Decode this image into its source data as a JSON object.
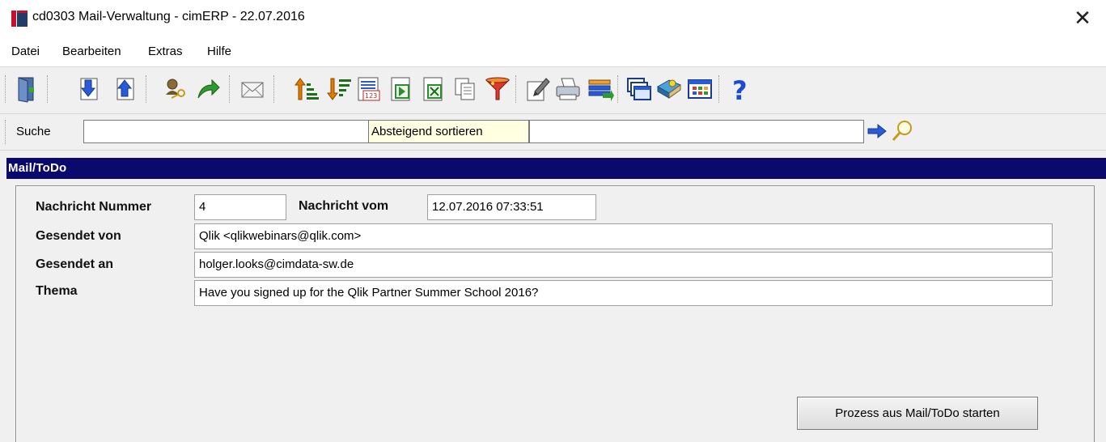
{
  "window": {
    "title": "cd0303 Mail-Verwaltung - cimERP - 22.07.2016",
    "close_glyph": "✕"
  },
  "menu": {
    "items": [
      {
        "label": "Datei"
      },
      {
        "label": "Bearbeiten"
      },
      {
        "label": "Extras"
      },
      {
        "label": "Hilfe"
      }
    ]
  },
  "toolbar": {
    "icons": [
      "exit-icon",
      "move-down-icon",
      "move-up-icon",
      "user-key-icon",
      "forward-icon",
      "mail-icon",
      "sort-ascending-icon",
      "sort-descending-icon",
      "number-list-icon",
      "export-icon",
      "excel-icon",
      "copy-icon",
      "filter-icon",
      "edit-document-icon",
      "print-icon",
      "transfer-icon",
      "windows-icon",
      "book-icon",
      "grid-icon",
      "help-icon"
    ]
  },
  "search": {
    "label": "Suche",
    "value": "",
    "tooltip": "Absteigend sortieren",
    "value2": ""
  },
  "section": {
    "title": "Mail/ToDo"
  },
  "form": {
    "number_label": "Nachricht Nummer",
    "number_value": "4",
    "date_label": "Nachricht vom",
    "date_value": "12.07.2016 07:33:51",
    "from_label": "Gesendet von",
    "from_value": "Qlik <qlikwebinars@qlik.com>",
    "to_label": "Gesendet an",
    "to_value": "holger.looks@cimdata-sw.de",
    "subject_label": "Thema",
    "subject_value": "Have you signed up for the Qlik Partner Summer School 2016?",
    "action_label": "Prozess aus Mail/ToDo starten"
  },
  "colors": {
    "header_bg": "#0a0a6e",
    "tooltip_bg": "#ffffe1",
    "window_bg": "#f0f0f0"
  }
}
